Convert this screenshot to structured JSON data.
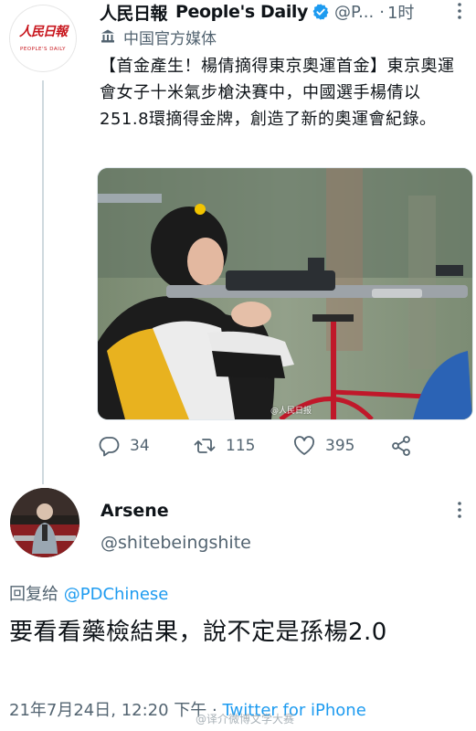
{
  "tweet": {
    "author_logo_cn": "人民日報",
    "author_logo_en": "PEOPLE'S DAILY",
    "name_cn": "人民日報",
    "name_en": "People's Daily",
    "handle": "@P...",
    "separator": "·",
    "time": "1时",
    "label": "中国官方媒体",
    "text": "【首金產生！楊倩摘得東京奧運首金】東京奧運會女子十米氣步槍決賽中，中國選手楊倩以251.8環摘得金牌，創造了新的奧運會紀錄。",
    "image_watermark": "@人民日报",
    "actions": {
      "replies": "34",
      "retweets": "115",
      "likes": "395"
    }
  },
  "reply": {
    "name": "Arsene",
    "handle": "@shitebeingshite",
    "reply_to_prefix": "回复给",
    "reply_to_handle": "@PDChinese",
    "text": "要看看藥檢結果，說不定是孫楊2.0",
    "date": "21年7月24日, 12:20 下午",
    "separator": " · ",
    "source": "Twitter for iPhone"
  },
  "bottom_watermark": "@译介微博文学大赛",
  "colors": {
    "accent": "#1d9bf0",
    "secondary_text": "#536471",
    "brand_red": "#c8161d"
  }
}
